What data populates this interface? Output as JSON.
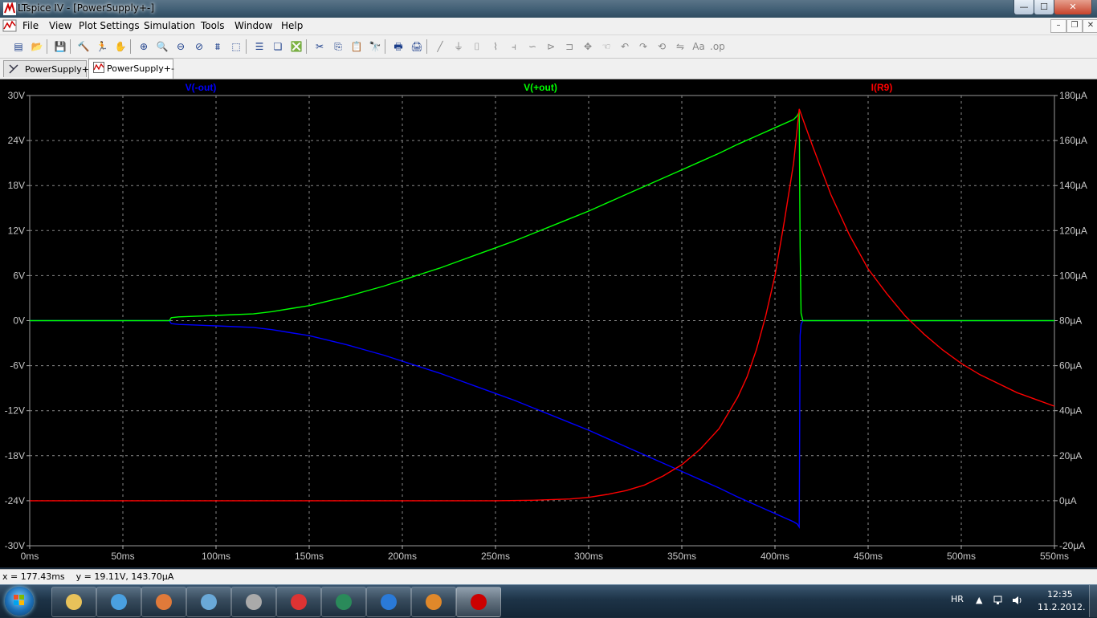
{
  "window": {
    "title": "LTspice IV - [PowerSupply+-]",
    "minimize": "—",
    "maximize": "☐",
    "close": "✕"
  },
  "menu": {
    "items": [
      "File",
      "View",
      "Plot Settings",
      "Simulation",
      "Tools",
      "Window",
      "Help"
    ],
    "mdi_buttons": [
      "–",
      "❐",
      "✕"
    ]
  },
  "toolbar": {
    "icons": [
      "new-schematic-icon",
      "open-icon",
      "save-icon",
      "control-panel-icon",
      "run-icon",
      "pan-hand-icon",
      "zoom-in-icon",
      "zoom-area-icon",
      "zoom-out-icon",
      "zoom-cancel-icon",
      "autorange-icon",
      "fit-icon",
      "tile-horizontal-icon",
      "cascade-icon",
      "close-all-icon",
      "cut-icon",
      "copy-icon",
      "paste-icon",
      "find-icon",
      "print-preview-icon",
      "print-icon",
      "wire-icon",
      "ground-icon",
      "label-icon",
      "resistor-icon",
      "capacitor-icon",
      "inductor-icon",
      "diode-icon",
      "component-icon",
      "move-icon",
      "drag-icon",
      "undo-icon",
      "redo-icon",
      "rotate-icon",
      "mirror-icon",
      "text-icon",
      "spice-directive-icon"
    ]
  },
  "tabs": [
    {
      "label": "PowerSupply+-",
      "active": false,
      "icon": "schematic-icon"
    },
    {
      "label": "PowerSupply+-",
      "active": true,
      "icon": "waveform-icon"
    }
  ],
  "status": {
    "cursor": "x = 177.43ms    y = 19.11V, 143.70µA"
  },
  "taskbar": {
    "apps": [
      "explorer-icon",
      "media-player-icon",
      "paint-icon",
      "image-viewer-icon",
      "utility-icon",
      "opera-icon",
      "oscilloscope-icon",
      "internet-explorer-icon",
      "firefox-icon",
      "ltspice-icon"
    ],
    "active_index": 9,
    "language": "HR",
    "time": "12:35",
    "date": "11.2.2012."
  },
  "chart_data": {
    "type": "line",
    "background": "#000000",
    "grid": true,
    "x_axis": {
      "range": [
        0,
        550
      ],
      "unit": "ms",
      "ticks": [
        "0ms",
        "50ms",
        "100ms",
        "150ms",
        "200ms",
        "250ms",
        "300ms",
        "350ms",
        "400ms",
        "450ms",
        "500ms",
        "550ms"
      ]
    },
    "y_axis_left": {
      "range": [
        -30,
        30
      ],
      "unit": "V",
      "ticks": [
        "30V",
        "24V",
        "18V",
        "12V",
        "6V",
        "0V",
        "-6V",
        "-12V",
        "-18V",
        "-24V",
        "-30V"
      ]
    },
    "y_axis_right": {
      "range": [
        -20,
        180
      ],
      "unit": "µA",
      "ticks": [
        "180µA",
        "160µA",
        "140µA",
        "120µA",
        "100µA",
        "80µA",
        "60µA",
        "40µA",
        "20µA",
        "0µA",
        "-20µA"
      ]
    },
    "series": [
      {
        "name": "V(-out)",
        "color": "#0000FF",
        "axis": "left",
        "x": [
          0,
          75,
          76,
          80,
          90,
          100,
          110,
          120,
          130,
          140,
          150,
          160,
          170,
          180,
          190,
          200,
          210,
          220,
          230,
          240,
          250,
          260,
          270,
          280,
          290,
          300,
          310,
          320,
          330,
          340,
          350,
          360,
          370,
          380,
          390,
          400,
          410,
          412,
          413,
          413.5,
          414,
          415,
          550
        ],
        "y": [
          0,
          0,
          -0.4,
          -0.5,
          -0.6,
          -0.7,
          -0.8,
          -0.9,
          -1.2,
          -1.6,
          -2.0,
          -2.6,
          -3.2,
          -3.9,
          -4.6,
          -5.4,
          -6.2,
          -7.0,
          -7.9,
          -8.8,
          -9.7,
          -10.6,
          -11.6,
          -12.6,
          -13.6,
          -14.6,
          -15.7,
          -16.8,
          -17.9,
          -19.0,
          -20.1,
          -21.2,
          -22.3,
          -23.5,
          -24.6,
          -25.7,
          -26.8,
          -27.1,
          -27.5,
          -2.0,
          -0.5,
          0,
          0
        ]
      },
      {
        "name": "V(+out)",
        "color": "#00FF00",
        "axis": "left",
        "x": [
          0,
          75,
          76,
          80,
          90,
          100,
          110,
          120,
          130,
          140,
          150,
          160,
          170,
          180,
          190,
          200,
          210,
          220,
          230,
          240,
          250,
          260,
          270,
          280,
          290,
          300,
          310,
          320,
          330,
          340,
          350,
          360,
          370,
          380,
          390,
          400,
          410,
          412,
          413,
          413.5,
          414,
          415,
          550
        ],
        "y": [
          0,
          0,
          0.4,
          0.5,
          0.6,
          0.7,
          0.8,
          0.9,
          1.2,
          1.6,
          2.0,
          2.6,
          3.2,
          3.9,
          4.6,
          5.4,
          6.2,
          7.0,
          7.9,
          8.8,
          9.7,
          10.6,
          11.6,
          12.6,
          13.6,
          14.6,
          15.7,
          16.8,
          17.9,
          19.0,
          20.1,
          21.2,
          22.3,
          23.5,
          24.6,
          25.7,
          26.8,
          27.3,
          27.8,
          10.0,
          1.0,
          0,
          0
        ]
      },
      {
        "name": "I(R9)",
        "color": "#FF0000",
        "axis": "right",
        "x": [
          0,
          250,
          270,
          290,
          300,
          310,
          320,
          330,
          340,
          350,
          360,
          370,
          380,
          385,
          390,
          395,
          400,
          405,
          410,
          413,
          420,
          430,
          440,
          450,
          460,
          470,
          480,
          490,
          500,
          510,
          520,
          530,
          540,
          550
        ],
        "y": [
          0,
          0,
          0.2,
          0.8,
          1.5,
          2.8,
          4.5,
          7,
          11,
          16,
          23,
          32,
          46,
          55,
          67,
          82,
          100,
          124,
          150,
          174,
          158,
          136,
          118,
          103,
          92,
          82,
          74,
          67,
          61,
          56,
          52,
          48,
          45,
          42
        ]
      }
    ]
  }
}
